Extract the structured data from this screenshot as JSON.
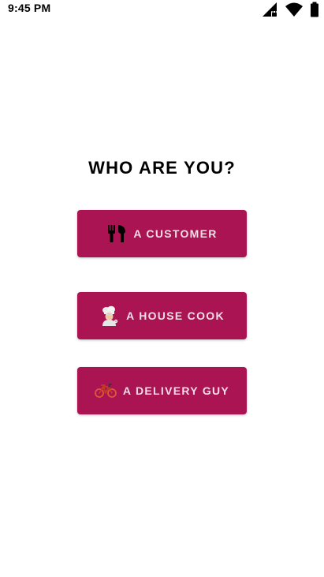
{
  "status_bar": {
    "time": "9:45 PM",
    "icons": [
      "signal-icon",
      "wifi-icon",
      "battery-icon"
    ]
  },
  "screen": {
    "title": "WHO ARE YOU?"
  },
  "roles": [
    {
      "label": "A CUSTOMER",
      "icon": "fork-knife-icon"
    },
    {
      "label": "A HOUSE COOK",
      "icon": "chef-icon"
    },
    {
      "label": "A DELIVERY GUY",
      "icon": "bicycle-icon"
    }
  ],
  "colors": {
    "button_bg": "#ab1452",
    "button_text": "#f4dde7",
    "page_bg": "#ffffff",
    "title_text": "#000000"
  }
}
